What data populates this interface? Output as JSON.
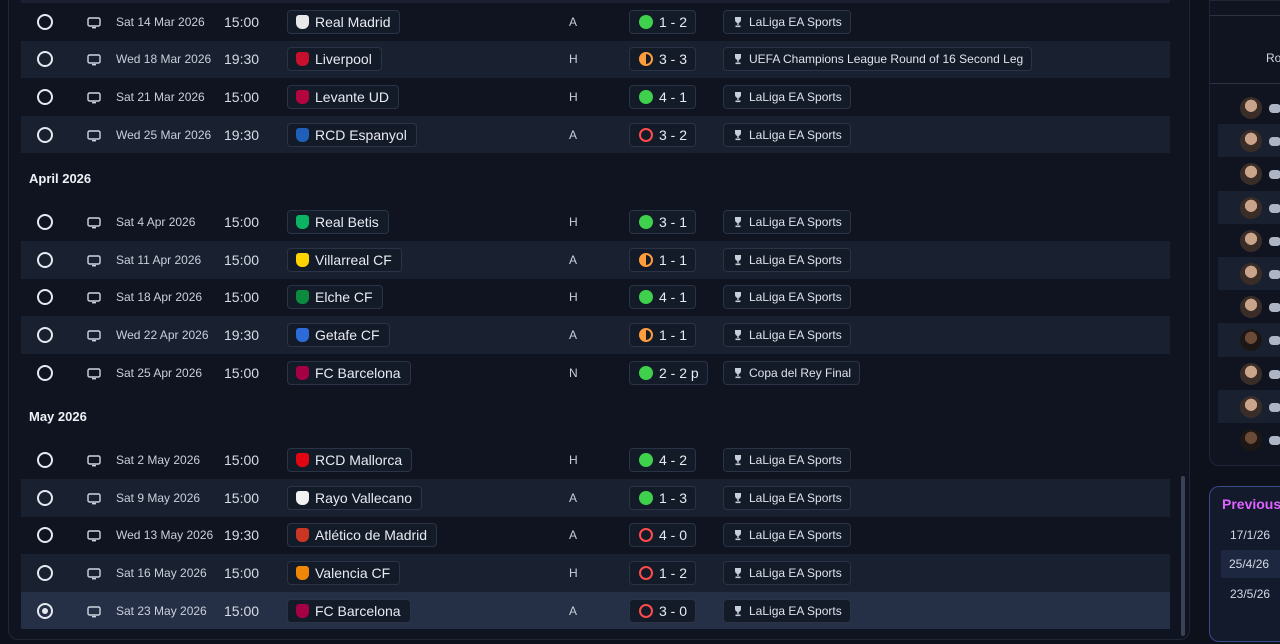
{
  "fixtures": [
    {
      "type": "match",
      "radio": "off",
      "date": "Sat 14 Mar 2026",
      "time": "15:00",
      "team": "Real Madrid",
      "venue": "A",
      "result": "W",
      "score": "1 - 2",
      "competition": "LaLiga EA Sports",
      "crest": "#e8e8e8",
      "alt": false
    },
    {
      "type": "match",
      "radio": "off",
      "date": "Wed 18 Mar 2026",
      "time": "19:30",
      "team": "Liverpool",
      "venue": "H",
      "result": "D",
      "score": "3 - 3",
      "competition": "UEFA Champions League Round of 16  Second Leg",
      "crest": "#c8102e",
      "alt": true
    },
    {
      "type": "match",
      "radio": "off",
      "date": "Sat 21 Mar 2026",
      "time": "15:00",
      "team": "Levante UD",
      "venue": "H",
      "result": "W",
      "score": "4 - 1",
      "competition": "LaLiga EA Sports",
      "crest": "#b4053f",
      "alt": false
    },
    {
      "type": "match",
      "radio": "off",
      "date": "Wed 25 Mar 2026",
      "time": "19:30",
      "team": "RCD Espanyol",
      "venue": "A",
      "result": "L",
      "score": "3 - 2",
      "competition": "LaLiga EA Sports",
      "crest": "#1f5fb8",
      "alt": true
    },
    {
      "type": "month",
      "label": "April 2026"
    },
    {
      "type": "match",
      "radio": "off",
      "date": "Sat 4 Apr 2026",
      "time": "15:00",
      "team": "Real Betis",
      "venue": "H",
      "result": "W",
      "score": "3 - 1",
      "competition": "LaLiga EA Sports",
      "crest": "#0bb363",
      "alt": false
    },
    {
      "type": "match",
      "radio": "off",
      "date": "Sat 11 Apr 2026",
      "time": "15:00",
      "team": "Villarreal CF",
      "venue": "A",
      "result": "D",
      "score": "1 - 1",
      "competition": "LaLiga EA Sports",
      "crest": "#ffd400",
      "alt": true
    },
    {
      "type": "match",
      "radio": "off",
      "date": "Sat 18 Apr 2026",
      "time": "15:00",
      "team": "Elche CF",
      "venue": "H",
      "result": "W",
      "score": "4 - 1",
      "competition": "LaLiga EA Sports",
      "crest": "#0c8a3e",
      "alt": false
    },
    {
      "type": "match",
      "radio": "off",
      "date": "Wed 22 Apr 2026",
      "time": "19:30",
      "team": "Getafe CF",
      "venue": "A",
      "result": "D",
      "score": "1 - 1",
      "competition": "LaLiga EA Sports",
      "crest": "#2c6bd8",
      "alt": true
    },
    {
      "type": "match",
      "radio": "off",
      "date": "Sat 25 Apr 2026",
      "time": "15:00",
      "team": "FC Barcelona",
      "venue": "N",
      "result": "W",
      "score": "2 - 2 p",
      "competition": "Copa del Rey Final",
      "crest": "#a50044",
      "alt": false
    },
    {
      "type": "month",
      "label": "May 2026"
    },
    {
      "type": "match",
      "radio": "off",
      "date": "Sat 2 May 2026",
      "time": "15:00",
      "team": "RCD Mallorca",
      "venue": "H",
      "result": "W",
      "score": "4 - 2",
      "competition": "LaLiga EA Sports",
      "crest": "#e20613",
      "alt": false
    },
    {
      "type": "match",
      "radio": "off",
      "date": "Sat 9 May 2026",
      "time": "15:00",
      "team": "Rayo Vallecano",
      "venue": "A",
      "result": "W",
      "score": "1 - 3",
      "competition": "LaLiga EA Sports",
      "crest": "#f2f2f2",
      "alt": true
    },
    {
      "type": "match",
      "radio": "off",
      "date": "Wed 13 May 2026",
      "time": "19:30",
      "team": "Atlético de Madrid",
      "venue": "A",
      "result": "L",
      "score": "4 - 0",
      "competition": "LaLiga EA Sports",
      "crest": "#cb3524",
      "alt": false
    },
    {
      "type": "match",
      "radio": "off",
      "date": "Sat 16 May 2026",
      "time": "15:00",
      "team": "Valencia CF",
      "venue": "H",
      "result": "L",
      "score": "1 - 2",
      "competition": "LaLiga EA Sports",
      "crest": "#ee8707",
      "alt": true
    },
    {
      "type": "match",
      "radio": "on",
      "date": "Sat 23 May 2026",
      "time": "15:00",
      "team": "FC Barcelona",
      "venue": "A",
      "result": "L",
      "score": "3 - 0",
      "competition": "LaLiga EA Sports",
      "crest": "#a50044",
      "alt": false,
      "selected": true
    }
  ],
  "right_panel": {
    "header_label": "Ro",
    "players": [
      {
        "alt": false,
        "tone": "light"
      },
      {
        "alt": true,
        "tone": "light"
      },
      {
        "alt": false,
        "tone": "light"
      },
      {
        "alt": true,
        "tone": "light"
      },
      {
        "alt": false,
        "tone": "light"
      },
      {
        "alt": true,
        "tone": "light"
      },
      {
        "alt": false,
        "tone": "light"
      },
      {
        "alt": true,
        "tone": "dark"
      },
      {
        "alt": false,
        "tone": "light"
      },
      {
        "alt": true,
        "tone": "light"
      },
      {
        "alt": false,
        "tone": "dark"
      }
    ]
  },
  "previous_card": {
    "title": "Previous M",
    "dates": [
      "17/1/26",
      "25/4/26",
      "23/5/26"
    ]
  },
  "colors": {
    "win": "#3fd14c",
    "draw": "#ff9d3c",
    "loss": "#ff4b4b",
    "accent": "#e163ff"
  },
  "icons": {
    "broadcast": "tv-icon",
    "competition": "trophy-icon",
    "controller": "gamepad-icon"
  }
}
